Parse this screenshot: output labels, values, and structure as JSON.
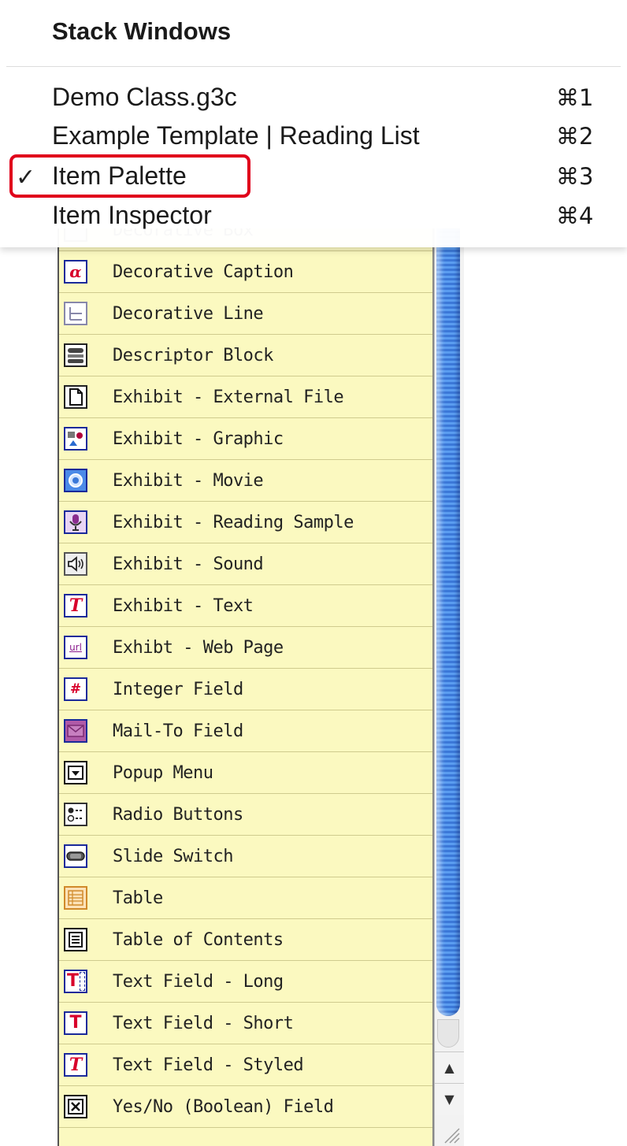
{
  "menu": {
    "title": "Stack Windows",
    "items": [
      {
        "label": "Demo Class.g3c",
        "shortcut": "⌘1",
        "checked": false
      },
      {
        "label": "Example Template | Reading List",
        "shortcut": "⌘2",
        "checked": false
      },
      {
        "label": "Item Palette",
        "shortcut": "⌘3",
        "checked": true
      },
      {
        "label": "Item Inspector",
        "shortcut": "⌘4",
        "checked": false
      }
    ],
    "check_mark": "✓",
    "highlight_color": "#e0001b"
  },
  "palette": {
    "background": "#fbf9c0",
    "items": [
      {
        "label": "Decorative Box",
        "icon": "decorative-box-icon"
      },
      {
        "label": "Decorative Caption",
        "icon": "alpha-caption-icon"
      },
      {
        "label": "Decorative Line",
        "icon": "line-icon"
      },
      {
        "label": "Descriptor Block",
        "icon": "descriptor-block-icon"
      },
      {
        "label": "Exhibit - External File",
        "icon": "file-icon"
      },
      {
        "label": "Exhibit - Graphic",
        "icon": "graphic-icon"
      },
      {
        "label": "Exhibit - Movie",
        "icon": "movie-icon"
      },
      {
        "label": "Exhibit - Reading Sample",
        "icon": "microphone-icon"
      },
      {
        "label": "Exhibit - Sound",
        "icon": "speaker-icon"
      },
      {
        "label": "Exhibit - Text",
        "icon": "text-t-icon"
      },
      {
        "label": "Exhibt - Web Page",
        "icon": "url-icon"
      },
      {
        "label": "Integer Field",
        "icon": "hash-icon"
      },
      {
        "label": "Mail-To Field",
        "icon": "envelope-icon"
      },
      {
        "label": "Popup Menu",
        "icon": "popup-icon"
      },
      {
        "label": "Radio Buttons",
        "icon": "radio-icon"
      },
      {
        "label": "Slide Switch",
        "icon": "slide-switch-icon"
      },
      {
        "label": "Table",
        "icon": "table-icon"
      },
      {
        "label": "Table of Contents",
        "icon": "contents-icon"
      },
      {
        "label": "Text Field - Long",
        "icon": "text-long-icon"
      },
      {
        "label": "Text Field - Short",
        "icon": "text-short-icon"
      },
      {
        "label": "Text Field - Styled",
        "icon": "text-styled-icon"
      },
      {
        "label": "Yes/No (Boolean) Field",
        "icon": "checkbox-x-icon"
      }
    ]
  },
  "scrollbar": {
    "up_arrow": "▲",
    "down_arrow": "▼"
  }
}
